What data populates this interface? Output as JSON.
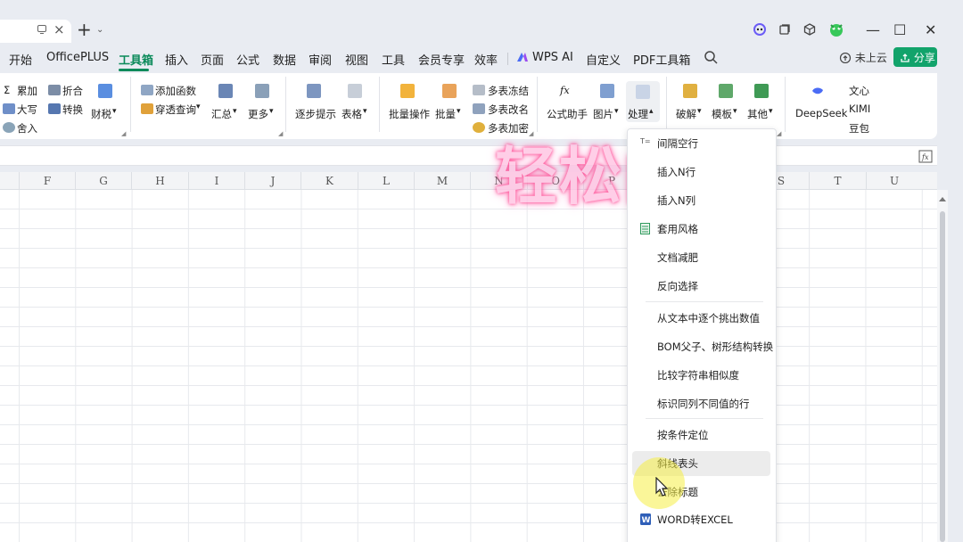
{
  "title_bar": {
    "tab_close": "×",
    "new_tab": "+",
    "new_tab_dropdown": "⌄",
    "window_controls": [
      "—",
      "☐",
      "✕"
    ]
  },
  "menu": {
    "items": [
      "开始",
      "OfficePLUS",
      "工具箱",
      "插入",
      "页面",
      "公式",
      "数据",
      "审阅",
      "视图",
      "工具",
      "会员专享",
      "效率",
      "WPS AI",
      "自定义",
      "PDF工具箱"
    ],
    "active": "工具箱",
    "cloud": "未上云",
    "share": "分享"
  },
  "ribbon": {
    "accumulate": "累加",
    "upper": "大写",
    "round": "舍入",
    "fold": "折合",
    "convert": "转换",
    "finance_tax": "财税",
    "add_function": "添加函数",
    "penetrate_query": "穿透查询",
    "summary": "汇总",
    "more": "更多",
    "step_hint": "逐步提示",
    "table": "表格",
    "batch_operation": "批量操作",
    "batch": "批量",
    "multi_freeze": "多表冻结",
    "multi_rename": "多表改名",
    "multi_encrypt": "多表加密",
    "formula_assistant": "公式助手",
    "picture": "图片",
    "process": "处理",
    "crack": "破解",
    "template": "模板",
    "other": "其他",
    "deepseek": "DeepSeek",
    "wenxin": "文心",
    "kimi": "KIMI",
    "doubao": "豆包"
  },
  "columns": [
    "F",
    "G",
    "H",
    "I",
    "J",
    "K",
    "L",
    "M",
    "N",
    "O",
    "P",
    "Q",
    "R",
    "S",
    "T",
    "U"
  ],
  "watermark": "轻松向暖",
  "dropdown": {
    "group1": [
      "间隔空行",
      "插入N行",
      "插入N列",
      "套用风格",
      "文档减肥",
      "反向选择"
    ],
    "group2": [
      "从文本中逐个挑出数值",
      "BOM父子、树形结构转换",
      "比较字符串相似度",
      "标识同列不同值的行"
    ],
    "group3": [
      "按条件定位",
      "斜线表头",
      "去除标题",
      "WORD转EXCEL"
    ]
  },
  "colors": {
    "accent": "#0b8a5a",
    "share_bg": "#12a36b",
    "watermark": "#ff3d8b"
  }
}
